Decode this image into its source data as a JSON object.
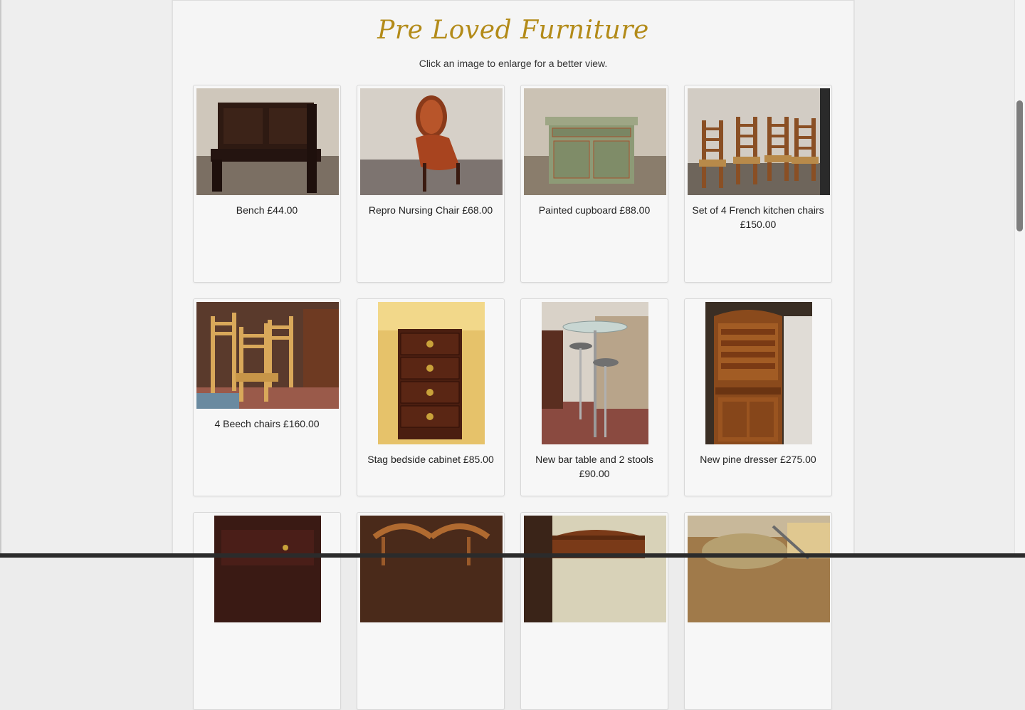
{
  "page": {
    "title": "Pre Loved Furniture",
    "subtitle": "Click an image to enlarge for a better view."
  },
  "products": [
    {
      "caption": "Bench £44.00",
      "icon": "bench-photo"
    },
    {
      "caption": "Repro Nursing Chair £68.00",
      "icon": "nursing-chair-photo"
    },
    {
      "caption": "Painted cupboard £88.00",
      "icon": "painted-cupboard-photo"
    },
    {
      "caption": "Set of 4 French kitchen chairs £150.00",
      "icon": "kitchen-chairs-photo"
    },
    {
      "caption": "4 Beech chairs £160.00",
      "icon": "beech-chairs-photo"
    },
    {
      "caption": "Stag bedside cabinet £85.00",
      "icon": "bedside-cabinet-photo"
    },
    {
      "caption": "New bar table and 2 stools £90.00",
      "icon": "bar-table-photo"
    },
    {
      "caption": "New pine dresser £275.00",
      "icon": "pine-dresser-photo"
    },
    {
      "caption": "",
      "icon": "dark-chest-photo"
    },
    {
      "caption": "",
      "icon": "wooden-chairs-photo"
    },
    {
      "caption": "",
      "icon": "half-moon-table-photo"
    },
    {
      "caption": "",
      "icon": "upholstered-chair-photo"
    }
  ],
  "colors": {
    "title": "#b38b19",
    "panel": "#f5f5f5",
    "background": "#ececec"
  }
}
